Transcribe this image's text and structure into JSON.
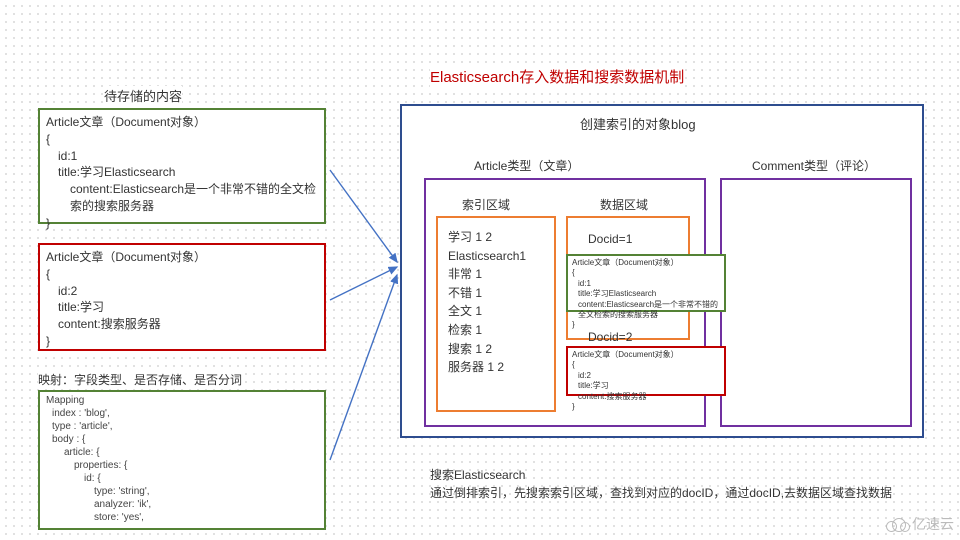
{
  "title": "Elasticsearch存入数据和搜索数据机制",
  "left_heading": "待存储的内容",
  "doc1": {
    "header": "Article文章（Document对象）",
    "open": "{",
    "id": "id:1",
    "title": "title:学习Elasticsearch",
    "content": "content:Elasticsearch是一个非常不错的全文检索的搜索服务器",
    "close": "}"
  },
  "doc2": {
    "header": "Article文章（Document对象）",
    "open": "{",
    "id": "id:2",
    "title": "title:学习",
    "content": "content:搜索服务器",
    "close": "}"
  },
  "mapping_label": "映射：字段类型、是否存储、是否分词",
  "mapping": {
    "l1": "Mapping",
    "l2": "index : 'blog',",
    "l3": "type : 'article',",
    "l4": "body : {",
    "l5": "article: {",
    "l6": "properties: {",
    "l7": "id: {",
    "l8": "type: 'string',",
    "l9": "analyzer: 'ik',",
    "l10": "store: 'yes',"
  },
  "blog_title": "创建索引的对象blog",
  "type_labels": {
    "article": "Article类型（文章）",
    "comment": "Comment类型（评论）"
  },
  "area_labels": {
    "index": "索引区域",
    "data": "数据区域"
  },
  "index_tokens": {
    "t1": "学习 1 2",
    "t2": "Elasticsearch1",
    "t3": "非常 1",
    "t4": "不错 1",
    "t5": "全文 1",
    "t6": "检索 1",
    "t7": "搜索 1 2",
    "t8": "服务器 1 2"
  },
  "docids": {
    "d1": "Docid=1",
    "d2": "Docid=2"
  },
  "mini1": {
    "header": "Article文章（Document对象）",
    "open": "{",
    "id": "id:1",
    "title": "title:学习Elasticsearch",
    "content": "content:Elasticsearch是一个非常不错的全文检索的搜索服务器",
    "close": "}"
  },
  "mini2": {
    "header": "Article文章（Document对象）",
    "open": "{",
    "id": "id:2",
    "title": "title:学习",
    "content": "content:搜索服务器",
    "close": "}"
  },
  "search_label": "搜索Elasticsearch",
  "search_desc": "通过倒排索引，先搜索索引区域，查找到对应的docID，通过docID,去数据区域查找数据",
  "watermark": "亿速云"
}
